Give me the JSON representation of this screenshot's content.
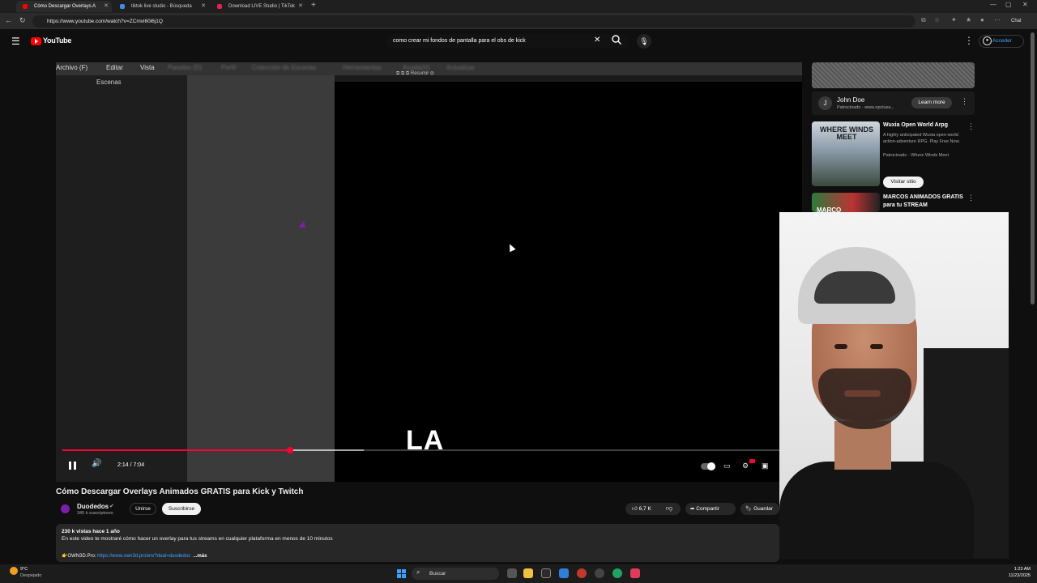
{
  "browser": {
    "tabs": [
      {
        "title": "Cómo Descargar Overlays A"
      },
      {
        "title": "tiktok live studio - Búsqueda"
      },
      {
        "title": "Download LIVE Studio | TikTok"
      }
    ],
    "new_tab": "+",
    "url": "https://www.youtube.com/watch?v=ZCmvi60i6j1Q",
    "chat_label": "Chat"
  },
  "youtube": {
    "logo_text": "YouTube",
    "search_query": "como crear mi fondos de pantalla para el obs de kick",
    "signin_label": "Acceder"
  },
  "player": {
    "obs_menus": [
      "Archivo (F)",
      "Editar",
      "Vista",
      "Paneles (D)",
      "Perfil",
      "Colección de Escenas",
      "Herramientas",
      "Ayuda(H)",
      "Actualizar"
    ],
    "obs_scenes_title": "Escenas",
    "obs_toolbar_label": "Resumir",
    "caption": "LA",
    "time": "2:14 / 7:04",
    "progress": 0.317,
    "buffered": 0.42
  },
  "video": {
    "title": "Cómo Descargar Overlays Animados GRATIS para Kick y Twitch",
    "channel": "Duodedos",
    "subscribers": "345 k suscriptores",
    "join_label": "Unirse",
    "subscribe_label": "Suscribirse",
    "likes": "6,7 K",
    "share_label": "Compartir",
    "save_label": "Guardar",
    "stats": "230 k vistas  hace 1 año",
    "description": "En este video te mostraré cómo hacer un overlay para tus streams en cualquier plataforma en menos de 10 minutos",
    "link_prefix": "👉OWN3D.Pro: ",
    "link": "https://www.own3d.pro/en/?deal=duodedos",
    "more_label": "...más"
  },
  "sidebar": {
    "ad": {
      "name": "John Doe",
      "sponsor": "Patrocinado · www.epclusa...",
      "learn_more": "Learn more"
    },
    "wuxia": {
      "thumb_text": "WHERE WINDS MEET",
      "title": "Wuxia Open World Arpg",
      "description": "A highly anticipated Wuxia open-world action-adventure RPG. Play Free Now.",
      "sponsor": "Patrocinado · Where Winds Meet",
      "visit_label": "Visitar sitio"
    },
    "marcos": {
      "thumb_text": "MARCO",
      "title": "MARCOS ANIMADOS GRATIS para tu STREAM"
    }
  },
  "taskbar": {
    "temp": "9°C",
    "weather": "Despejado",
    "search_label": "Buscar",
    "time": "1:23 AM",
    "date": "11/23/2025"
  }
}
